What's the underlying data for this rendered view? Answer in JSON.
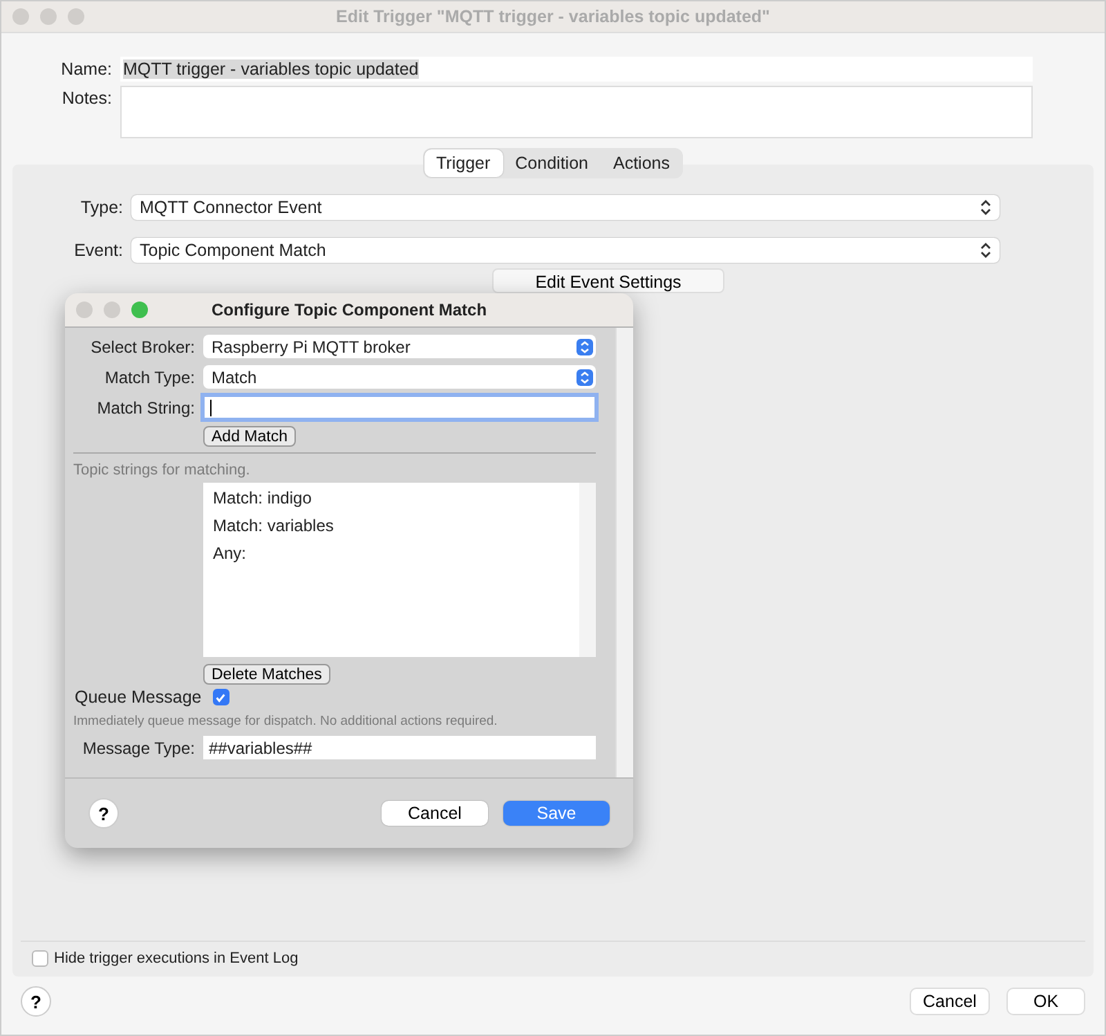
{
  "window": {
    "title": "Edit Trigger \"MQTT trigger - variables topic updated\""
  },
  "name": {
    "label": "Name:",
    "value": "MQTT trigger - variables topic updated"
  },
  "notes": {
    "label": "Notes:"
  },
  "tabs": [
    {
      "label": "Trigger",
      "selected": true
    },
    {
      "label": "Condition",
      "selected": false
    },
    {
      "label": "Actions",
      "selected": false
    }
  ],
  "type": {
    "label": "Type:",
    "value": "MQTT Connector Event"
  },
  "event": {
    "label": "Event:",
    "value": "Topic Component Match"
  },
  "edit_settings_button": "Edit Event Settings",
  "dialog": {
    "title": "Configure Topic Component Match",
    "broker": {
      "label": "Select Broker:",
      "value": "Raspberry Pi MQTT broker"
    },
    "match_type": {
      "label": "Match Type:",
      "value": "Match"
    },
    "match_string": {
      "label": "Match String:"
    },
    "add_button": "Add Match",
    "list_hint": "Topic strings for matching.",
    "matches": [
      "Match: indigo",
      "Match: variables",
      "Any:"
    ],
    "delete_button": "Delete Matches",
    "queue": {
      "label": "Queue Message",
      "checked": true
    },
    "queue_hint": "Immediately queue message for dispatch.  No additional actions required.",
    "message_type": {
      "label": "Message Type:",
      "value": "##variables##"
    },
    "help": "?",
    "buttons": [
      "Cancel",
      "Save"
    ]
  },
  "hide_executions": {
    "label": "Hide trigger executions in Event Log",
    "checked": false
  },
  "help": "?",
  "buttons": [
    "Cancel",
    "OK"
  ]
}
